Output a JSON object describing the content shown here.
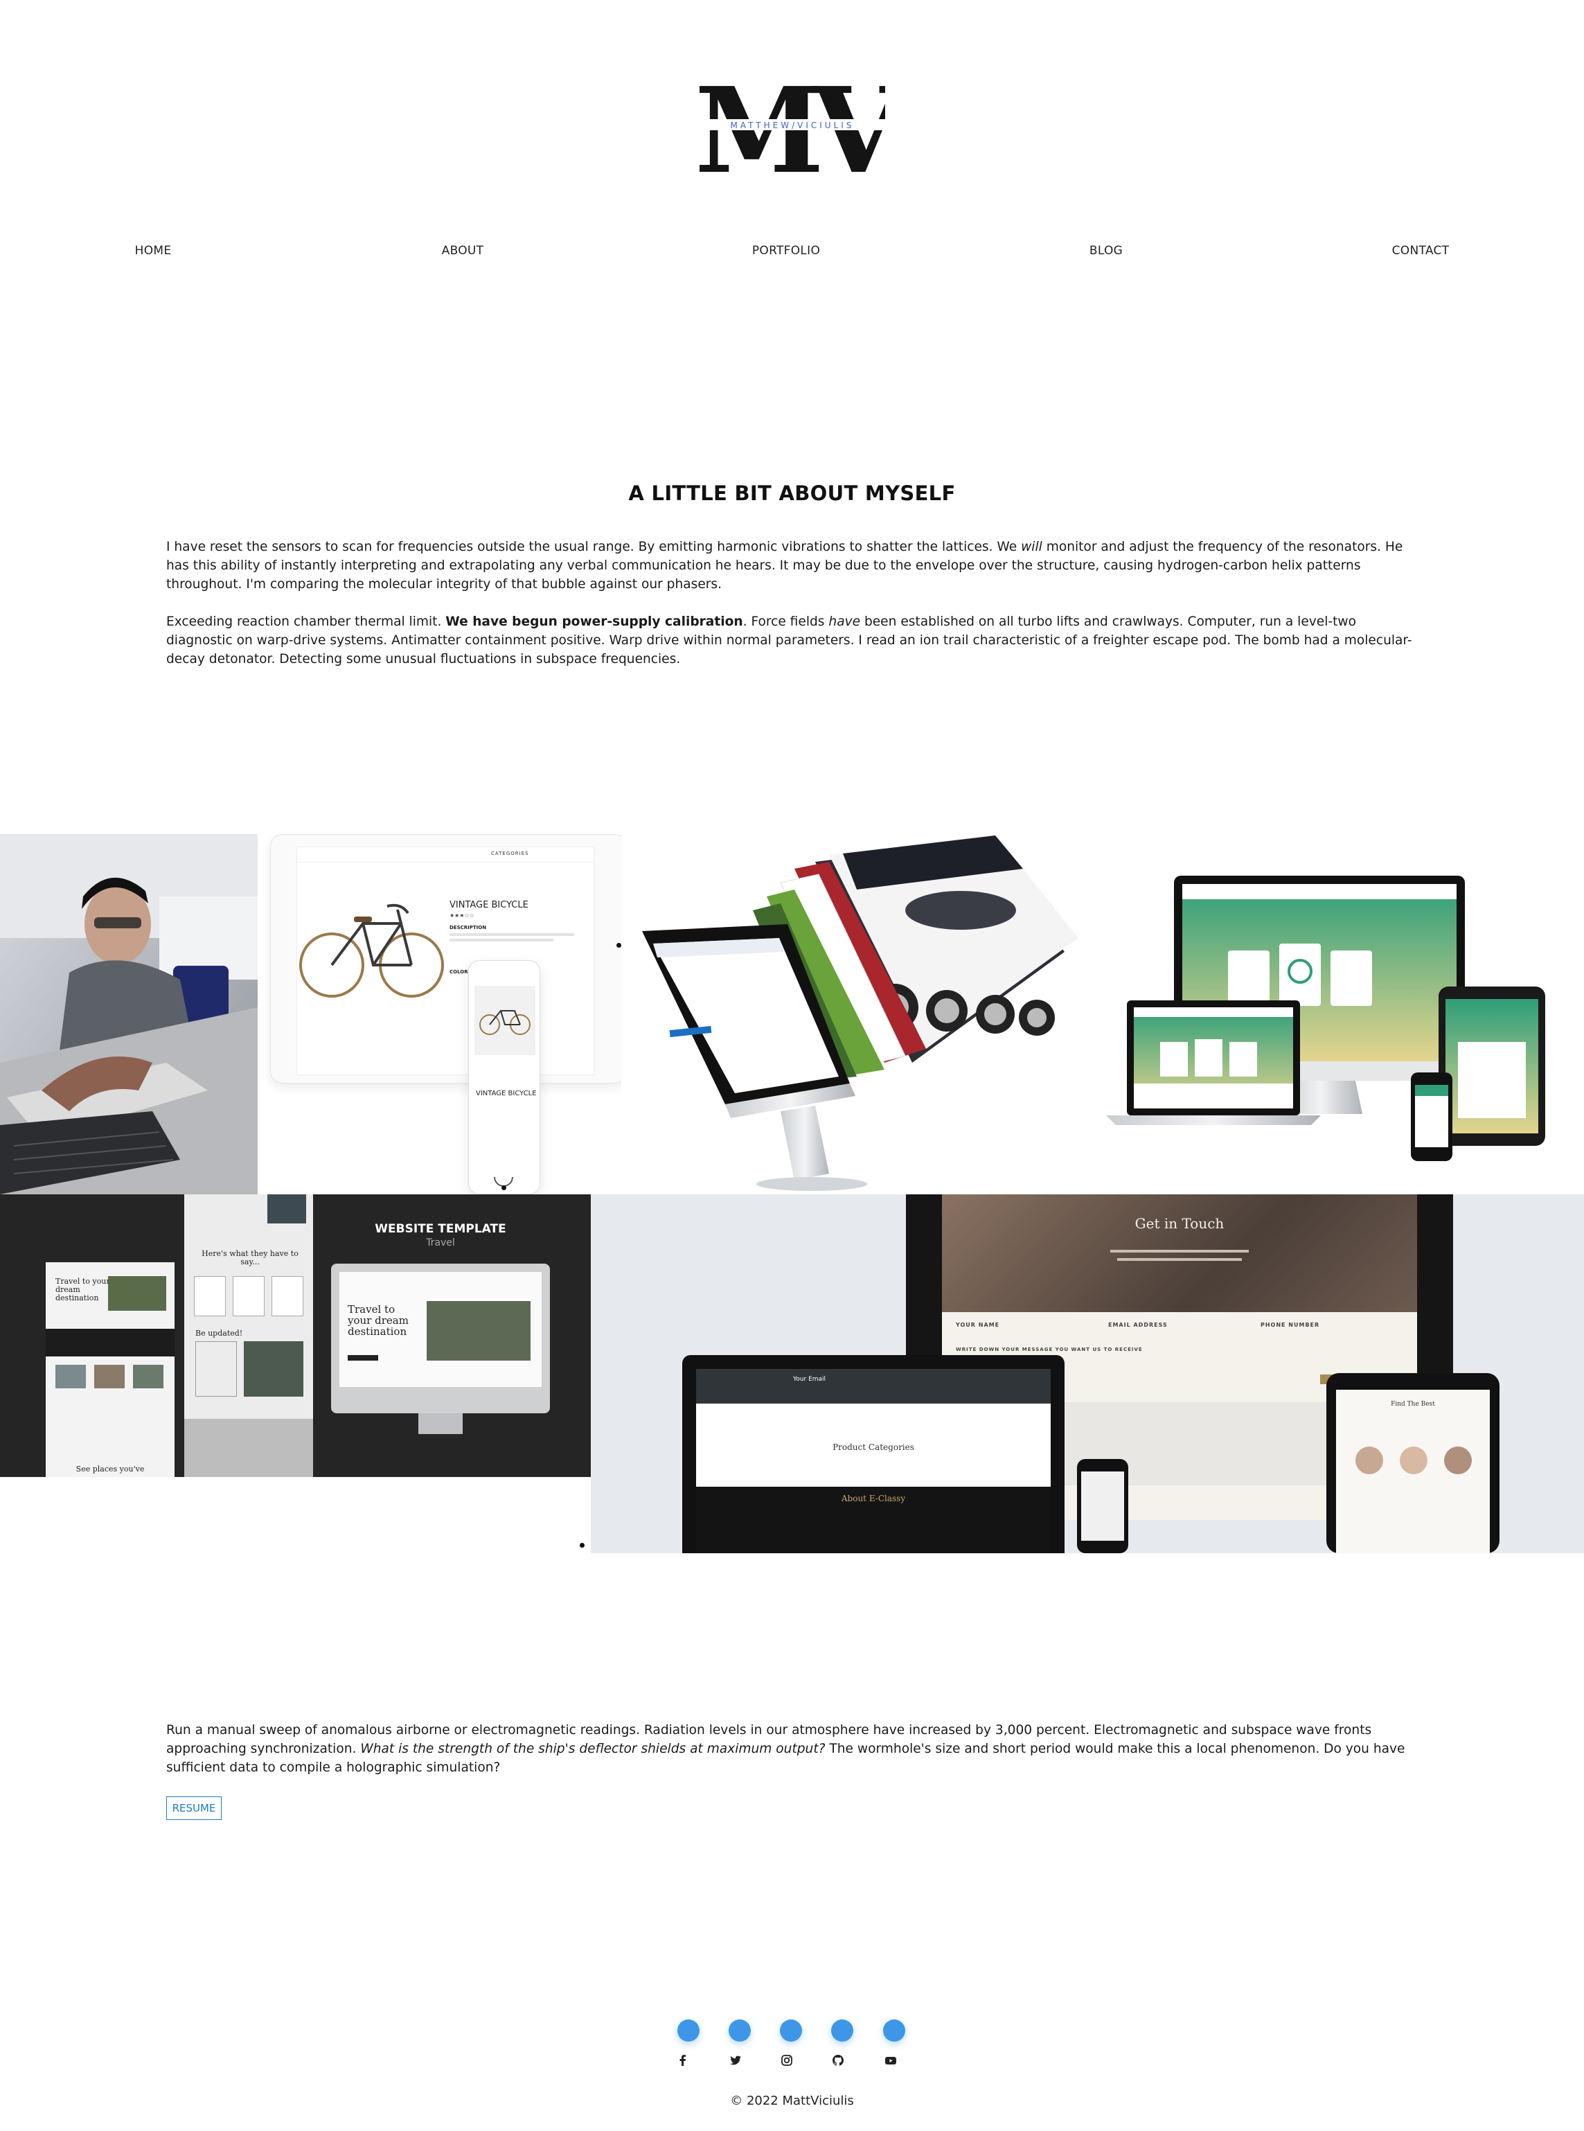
{
  "brand": {
    "logo_letters": "MV",
    "logo_subtitle": "MATTHEW/VICIULIS",
    "accent_color": "#3e5fd6"
  },
  "nav": {
    "items": [
      {
        "label": "HOME"
      },
      {
        "label": "ABOUT"
      },
      {
        "label": "PORTFOLIO"
      },
      {
        "label": "BLOG"
      },
      {
        "label": "CONTACT"
      }
    ]
  },
  "about": {
    "title": "A LITTLE BIT ABOUT MYSELF",
    "p1_a": "I have reset the sensors to scan for frequencies outside the usual range. By emitting harmonic vibrations to shatter the lattices. We ",
    "p1_em": "will",
    "p1_b": " monitor and adjust the frequency of the resonators. He has this ability of instantly interpreting and extrapolating any verbal communication he hears. It may be due to the envelope over the structure, causing hydrogen-carbon helix patterns throughout. I'm comparing the molecular integrity of that bubble against our phasers.",
    "p2_a": "Exceeding reaction chamber thermal limit. ",
    "p2_strong": "We have begun power-supply calibration",
    "p2_b": ". Force fields ",
    "p2_em": "have",
    "p2_c": " been established on all turbo lifts and crawlways. Computer, run a level-two diagnostic on warp-drive systems. Antimatter containment positive. Warp drive within normal parameters. I read an ion trail characteristic of a freighter escape pod. The bomb had a molecular-decay detonator. Detecting some unusual fluctuations in subspace frequencies."
  },
  "portfolio": {
    "bicycle": {
      "product_title": "VINTAGE BICYCLE",
      "description_label": "DESCRIPTION",
      "color_label": "COLOR",
      "nav_categories": "CATEGORIES"
    },
    "template": {
      "title": "WEBSITE TEMPLATE",
      "subtitle": "Travel",
      "hero_text": "Travel to your dream destination",
      "testimonial_heading": "Here's what they have to say...",
      "updated_heading": "Be updated!",
      "places_heading": "See places you've"
    },
    "classy": {
      "contact_heading": "Get in Touch",
      "field_name": "YOUR NAME",
      "field_email": "EMAIL ADDRESS",
      "field_phone": "PHONE NUMBER",
      "message_label": "WRITE DOWN YOUR MESSAGE YOU WANT US TO RECEIVE",
      "email_label": "Your Email",
      "categories_heading": "Product Categories",
      "about_heading": "About E-Classy",
      "team_heading": "Find The Best"
    }
  },
  "bottom": {
    "p3_a": "Run a manual sweep of anomalous airborne or electromagnetic readings. Radiation levels in our atmosphere have increased by 3,000 percent. Electromagnetic and subspace wave fronts approaching synchronization. ",
    "p3_em": "What is the strength of the ship's deflector shields at maximum output?",
    "p3_b": " The wormhole's size and short period would make this a local phenomenon. Do you have sufficient data to compile a holographic simulation?",
    "resume_label": "RESUME"
  },
  "footer": {
    "social": [
      "facebook-icon",
      "twitter-icon",
      "instagram-icon",
      "github-icon",
      "youtube-icon"
    ],
    "social_color": "#3e96e8",
    "copyright": "© 2022 MattViciulis"
  }
}
